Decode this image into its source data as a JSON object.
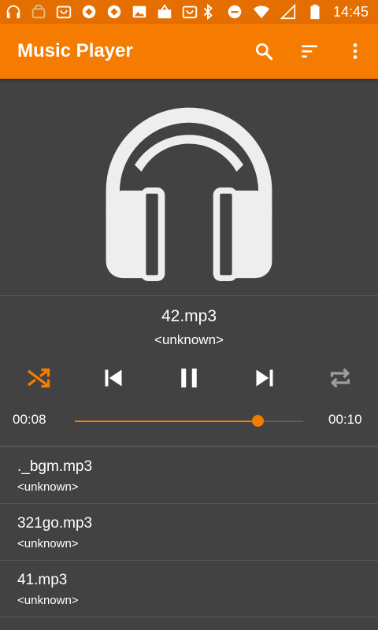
{
  "status_bar": {
    "time": "14:45",
    "icons_left": [
      "headphones-icon",
      "android-debug-icon",
      "shopping-icon",
      "app-icon",
      "app-icon",
      "image-icon",
      "briefcase-icon",
      "shopping-icon"
    ],
    "icons_right": [
      "bluetooth-icon",
      "do-not-disturb-icon",
      "wifi-icon",
      "signal-icon",
      "battery-icon"
    ]
  },
  "app_bar": {
    "title": "Music Player",
    "actions": [
      "search-icon",
      "sort-icon",
      "more-vert-icon"
    ]
  },
  "now_playing": {
    "title": "42.mp3",
    "artist": "<unknown>",
    "elapsed": "00:08",
    "duration": "00:10",
    "progress": 0.8,
    "shuffle_on": true,
    "repeat_on": false,
    "state": "playing"
  },
  "playlist": [
    {
      "title": "._bgm.mp3",
      "artist": "<unknown>"
    },
    {
      "title": "321go.mp3",
      "artist": "<unknown>"
    },
    {
      "title": "41.mp3",
      "artist": "<unknown>"
    }
  ],
  "colors": {
    "status_bar": "#e46f00",
    "accent": "#f57c00",
    "background": "#424242",
    "text": "#ffffff"
  }
}
